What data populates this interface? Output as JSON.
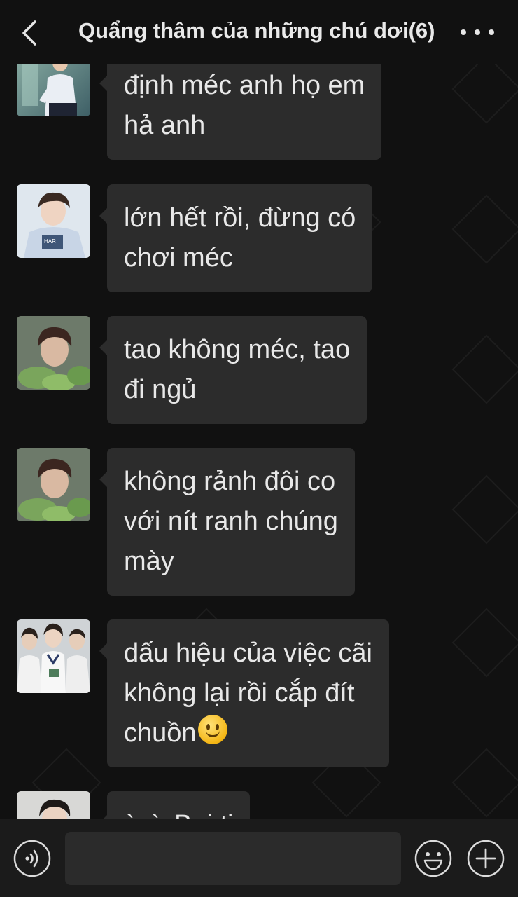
{
  "header": {
    "title": "Quẩng thâm của những chú dơi(6)"
  },
  "messages": [
    {
      "avatar": "avatar-man-white-shirt",
      "lines": [
        "định méc anh họ em",
        "hả anh"
      ]
    },
    {
      "avatar": "avatar-boy-hoodie",
      "lines": [
        "lớn hết rồi, đừng có",
        "chơi méc"
      ]
    },
    {
      "avatar": "avatar-boy-plants",
      "lines": [
        "tao không méc, tao",
        "đi ngủ"
      ]
    },
    {
      "avatar": "avatar-boy-plants",
      "lines": [
        "không rảnh đôi co",
        "với nít ranh chúng",
        "mày"
      ]
    },
    {
      "avatar": "avatar-group-boys",
      "lines": [
        "dấu hiệu của việc cãi",
        "không lại rồi cắp đít",
        "chuồn"
      ],
      "emoji": "slightly-smiling-face"
    },
    {
      "avatar": "avatar-boy-dark-hair",
      "lines": [
        "ừ ừ Bai ti"
      ]
    }
  ],
  "composer": {
    "placeholder": ""
  },
  "colors": {
    "background": "#111111",
    "bubble": "#2c2c2c",
    "text": "#e8e8e8",
    "bar": "#1b1b1b"
  }
}
